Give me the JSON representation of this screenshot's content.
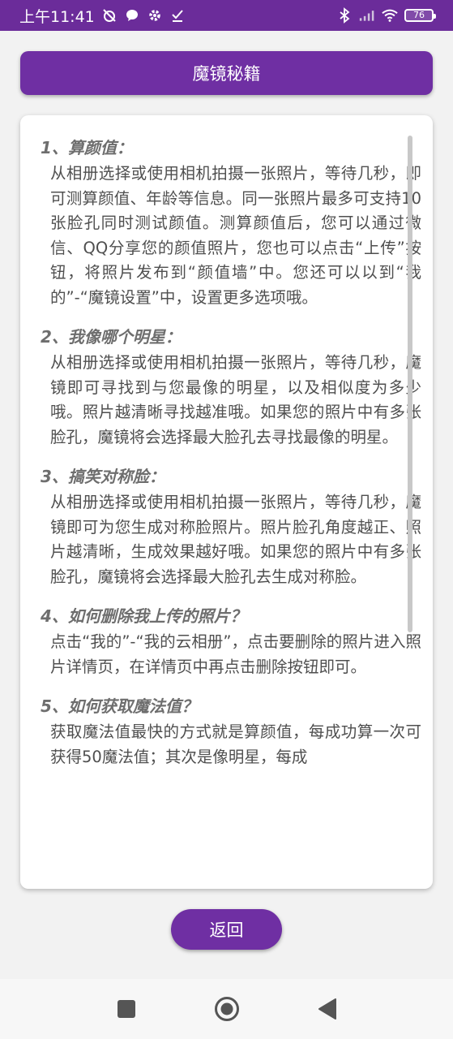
{
  "status_bar": {
    "time": "上午11:41",
    "battery": "76",
    "icons": [
      "alarm-off-icon",
      "chat-bubble-icon",
      "gear-icon",
      "download-done-icon",
      "bluetooth-icon",
      "signal-icon",
      "wifi-icon",
      "battery-icon"
    ]
  },
  "header": {
    "title": "魔镜秘籍"
  },
  "sections": [
    {
      "title": "1、算颜值：",
      "body": "从相册选择或使用相机拍摄一张照片，等待几秒，即可测算颜值、年龄等信息。同一张照片最多可支持10张脸孔同时测试颜值。测算颜值后，您可以通过微信、QQ分享您的颜值照片，您也可以点击“上传”按钮，将照片发布到“颜值墙”中。您还可以以到“我的”-“魔镜设置”中，设置更多选项哦。"
    },
    {
      "title": "2、我像哪个明星：",
      "body": "从相册选择或使用相机拍摄一张照片，等待几秒，魔镜即可寻找到与您最像的明星，以及相似度为多少哦。照片越清晰寻找越准哦。如果您的照片中有多张脸孔，魔镜将会选择最大脸孔去寻找最像的明星。"
    },
    {
      "title": "3、搞笑对称脸：",
      "body": "从相册选择或使用相机拍摄一张照片，等待几秒，魔镜即可为您生成对称脸照片。照片脸孔角度越正、照片越清晰，生成效果越好哦。如果您的照片中有多张脸孔，魔镜将会选择最大脸孔去生成对称脸。"
    },
    {
      "title": "4、如何删除我上传的照片？",
      "body": "点击“我的”-“我的云相册”，点击要删除的照片进入照片详情页，在详情页中再点击删除按钮即可。"
    },
    {
      "title": "5、如何获取魔法值？",
      "body": "获取魔法值最快的方式就是算颜值，每成功算一次可获得50魔法值；其次是像明星，每成"
    }
  ],
  "footer": {
    "back_label": "返回"
  },
  "nav": {
    "icons": [
      "square-icon",
      "circle-home-icon",
      "triangle-back-icon"
    ]
  },
  "colors": {
    "accent": "#6f2fa3",
    "status_bar": "#6b2c9a"
  }
}
